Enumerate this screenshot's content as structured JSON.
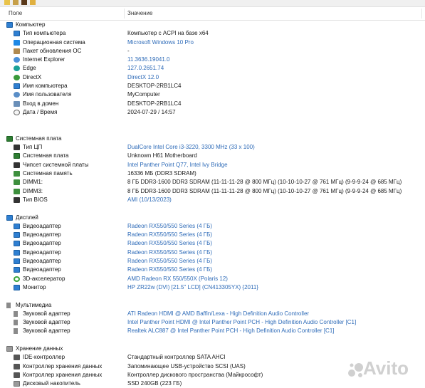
{
  "header": {
    "field_label": "Поле",
    "value_label": "Значение"
  },
  "rows": [
    {
      "kind": "section",
      "icon": "computer-icon",
      "iconClass": "monitor",
      "label": "Компьютер",
      "value": "",
      "link": false
    },
    {
      "kind": "item",
      "icon": "computer-type-icon",
      "iconClass": "monitor",
      "label": "Тип компьютера",
      "value": "Компьютер с ACPI на базе x64",
      "link": false
    },
    {
      "kind": "item",
      "icon": "windows-icon",
      "iconClass": "win",
      "label": "Операционная система",
      "value": "Microsoft Windows 10 Pro",
      "link": true
    },
    {
      "kind": "item",
      "icon": "package-icon",
      "iconClass": "pkg",
      "label": "Пакет обновления ОС",
      "value": "-",
      "link": false
    },
    {
      "kind": "item",
      "icon": "internet-explorer-icon",
      "iconClass": "ie",
      "label": "Internet Explorer",
      "value": "11.3636.19041.0",
      "link": true
    },
    {
      "kind": "item",
      "icon": "edge-icon",
      "iconClass": "edge",
      "label": "Edge",
      "value": "127.0.2651.74",
      "link": true
    },
    {
      "kind": "item",
      "icon": "directx-icon",
      "iconClass": "dx",
      "label": "DirectX",
      "value": "DirectX 12.0",
      "link": true
    },
    {
      "kind": "item",
      "icon": "computer-name-icon",
      "iconClass": "monitor",
      "label": "Имя компьютера",
      "value": "DESKTOP-2RB1LC4",
      "link": false
    },
    {
      "kind": "item",
      "icon": "user-icon",
      "iconClass": "user",
      "label": "Имя пользователя",
      "value": "MyComputer",
      "link": false
    },
    {
      "kind": "item",
      "icon": "domain-icon",
      "iconClass": "domain",
      "label": "Вход в домен",
      "value": "DESKTOP-2RB1LC4",
      "link": false
    },
    {
      "kind": "item",
      "icon": "clock-icon",
      "iconClass": "clock",
      "label": "Дата / Время",
      "value": "2024-07-29 / 14:57",
      "link": false
    },
    {
      "kind": "spacer"
    },
    {
      "kind": "spacer"
    },
    {
      "kind": "section",
      "icon": "motherboard-icon",
      "iconClass": "board",
      "label": "Системная плата",
      "value": "",
      "link": false
    },
    {
      "kind": "item",
      "icon": "cpu-icon",
      "iconClass": "chip",
      "label": "Тип ЦП",
      "value": "DualCore Intel Core i3-3220, 3300 MHz (33 x 100)",
      "link": true
    },
    {
      "kind": "item",
      "icon": "board-icon",
      "iconClass": "board",
      "label": "Системная плата",
      "value": "Unknown H61 Motherboard",
      "link": false
    },
    {
      "kind": "item",
      "icon": "chipset-icon",
      "iconClass": "chip",
      "label": "Чипсет системной платы",
      "value": "Intel Panther Point Q77, Intel Ivy Bridge",
      "link": true
    },
    {
      "kind": "item",
      "icon": "memory-icon",
      "iconClass": "ram",
      "label": "Системная память",
      "value": "16336 МБ  (DDR3 SDRAM)",
      "link": false
    },
    {
      "kind": "item",
      "icon": "dimm-icon",
      "iconClass": "ram",
      "label": "DIMM1:",
      "value": "8 ГБ DDR3-1600 DDR3 SDRAM  (11-11-11-28 @ 800 МГц)  (10-10-10-27 @ 761 МГц)  (9-9-9-24 @ 685 МГц)",
      "link": false
    },
    {
      "kind": "item",
      "icon": "dimm-icon",
      "iconClass": "ram",
      "label": "DIMM3:",
      "value": "8 ГБ DDR3-1600 DDR3 SDRAM  (11-11-11-28 @ 800 МГц)  (10-10-10-27 @ 761 МГц)  (9-9-9-24 @ 685 МГц)",
      "link": false
    },
    {
      "kind": "item",
      "icon": "bios-icon",
      "iconClass": "chip",
      "label": "Тип BIOS",
      "value": "AMI (10/13/2023)",
      "link": true
    },
    {
      "kind": "spacer"
    },
    {
      "kind": "section",
      "icon": "display-icon",
      "iconClass": "monitor",
      "label": "Дисплей",
      "value": "",
      "link": false
    },
    {
      "kind": "item",
      "icon": "video-adapter-icon",
      "iconClass": "monitor",
      "label": "Видеоадаптер",
      "value": "Radeon RX550/550 Series  (4 ГБ)",
      "link": true
    },
    {
      "kind": "item",
      "icon": "video-adapter-icon",
      "iconClass": "monitor",
      "label": "Видеоадаптер",
      "value": "Radeon RX550/550 Series  (4 ГБ)",
      "link": true
    },
    {
      "kind": "item",
      "icon": "video-adapter-icon",
      "iconClass": "monitor",
      "label": "Видеоадаптер",
      "value": "Radeon RX550/550 Series  (4 ГБ)",
      "link": true
    },
    {
      "kind": "item",
      "icon": "video-adapter-icon",
      "iconClass": "monitor",
      "label": "Видеоадаптер",
      "value": "Radeon RX550/550 Series  (4 ГБ)",
      "link": true
    },
    {
      "kind": "item",
      "icon": "video-adapter-icon",
      "iconClass": "monitor",
      "label": "Видеоадаптер",
      "value": "Radeon RX550/550 Series  (4 ГБ)",
      "link": true
    },
    {
      "kind": "item",
      "icon": "video-adapter-icon",
      "iconClass": "monitor",
      "label": "Видеоадаптер",
      "value": "Radeon RX550/550 Series  (4 ГБ)",
      "link": true
    },
    {
      "kind": "item",
      "icon": "3d-accelerator-icon",
      "iconClass": "d3",
      "label": "3D-акселератор",
      "value": "AMD Radeon RX 550/550X (Polaris 12)",
      "link": true
    },
    {
      "kind": "item",
      "icon": "monitor-icon",
      "iconClass": "monitor",
      "label": "Монитор",
      "value": "HP ZR22w (DVI)  [21.5\" LCD]  (CN413305YX)  {2011}",
      "link": true
    },
    {
      "kind": "spacer"
    },
    {
      "kind": "section",
      "icon": "multimedia-icon",
      "iconClass": "audio",
      "label": "Мультимедиа",
      "value": "",
      "link": false
    },
    {
      "kind": "item",
      "icon": "sound-adapter-icon",
      "iconClass": "audio",
      "label": "Звуковой адаптер",
      "value": "ATI Radeon HDMI @ AMD Baffin/Lexa - High Definition Audio Controller",
      "link": true
    },
    {
      "kind": "item",
      "icon": "sound-adapter-icon",
      "iconClass": "audio",
      "label": "Звуковой адаптер",
      "value": "Intel Panther Point HDMI @ Intel Panther Point PCH - High Definition Audio Controller [C1]",
      "link": true
    },
    {
      "kind": "item",
      "icon": "sound-adapter-icon",
      "iconClass": "audio",
      "label": "Звуковой адаптер",
      "value": "Realtek ALC887 @ Intel Panther Point PCH - High Definition Audio Controller [C1]",
      "link": true
    },
    {
      "kind": "spacer"
    },
    {
      "kind": "section",
      "icon": "storage-icon",
      "iconClass": "drive",
      "label": "Хранение данных",
      "value": "",
      "link": false
    },
    {
      "kind": "item",
      "icon": "ide-controller-icon",
      "iconClass": "ctrl",
      "label": "IDE-контроллер",
      "value": "Стандартный контроллер SATA AHCI",
      "link": false
    },
    {
      "kind": "item",
      "icon": "storage-controller-icon",
      "iconClass": "ctrl",
      "label": "Контроллер хранения данных",
      "value": "Запоминающее USB-устройство SCSI (UAS)",
      "link": false
    },
    {
      "kind": "item",
      "icon": "storage-controller-icon",
      "iconClass": "ctrl",
      "label": "Контроллер хранения данных",
      "value": "Контроллер дискового пространства (Майкрософт)",
      "link": false
    },
    {
      "kind": "item",
      "icon": "disk-drive-icon",
      "iconClass": "drive",
      "label": "Дисковый накопитель",
      "value": "SSD 240GB  (223 ГБ)",
      "link": false
    }
  ],
  "watermark": {
    "text": "Avito"
  }
}
